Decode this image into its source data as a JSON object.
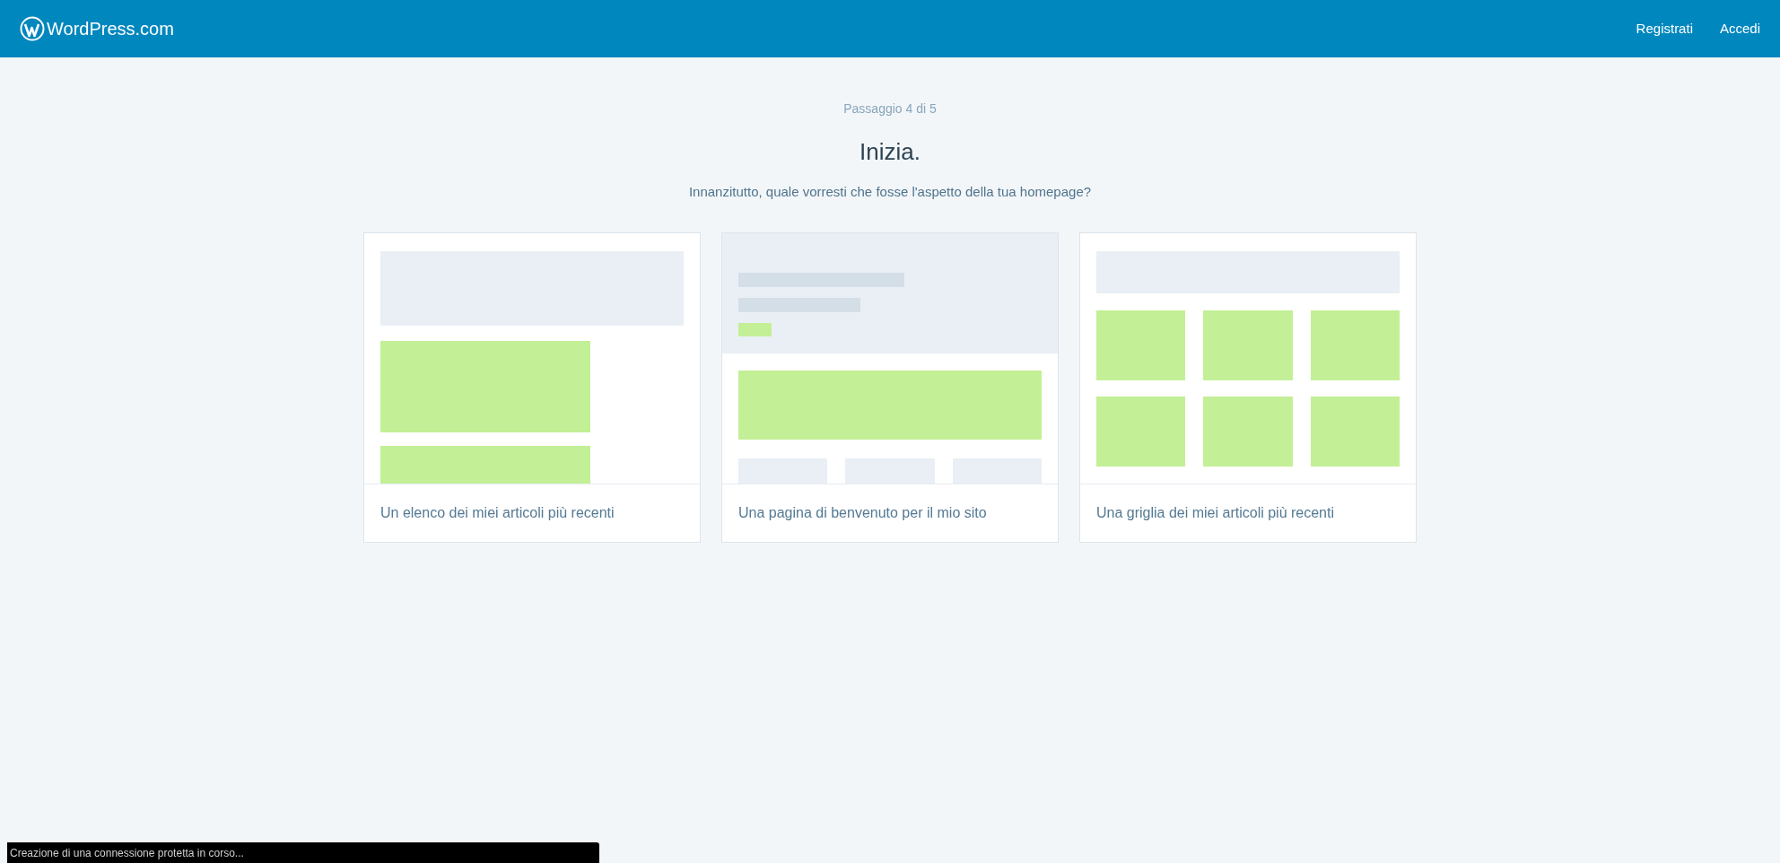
{
  "header": {
    "logo": "WordPress.com",
    "links": [
      "Registrati",
      "Accedi"
    ]
  },
  "step": "Passaggio 4 di 5",
  "title": "Inizia.",
  "subtitle": "Innanzitutto, quale vorresti che fosse l'aspetto della tua homepage?",
  "options": [
    {
      "kind": "list",
      "label": "Un elenco dei miei articoli più recenti"
    },
    {
      "kind": "welcome",
      "label": "Una pagina di benvenuto per il mio sito"
    },
    {
      "kind": "grid",
      "label": "Una griglia dei miei articoli più recenti"
    }
  ],
  "status_bar": "Creazione di una connessione protetta in corso..."
}
